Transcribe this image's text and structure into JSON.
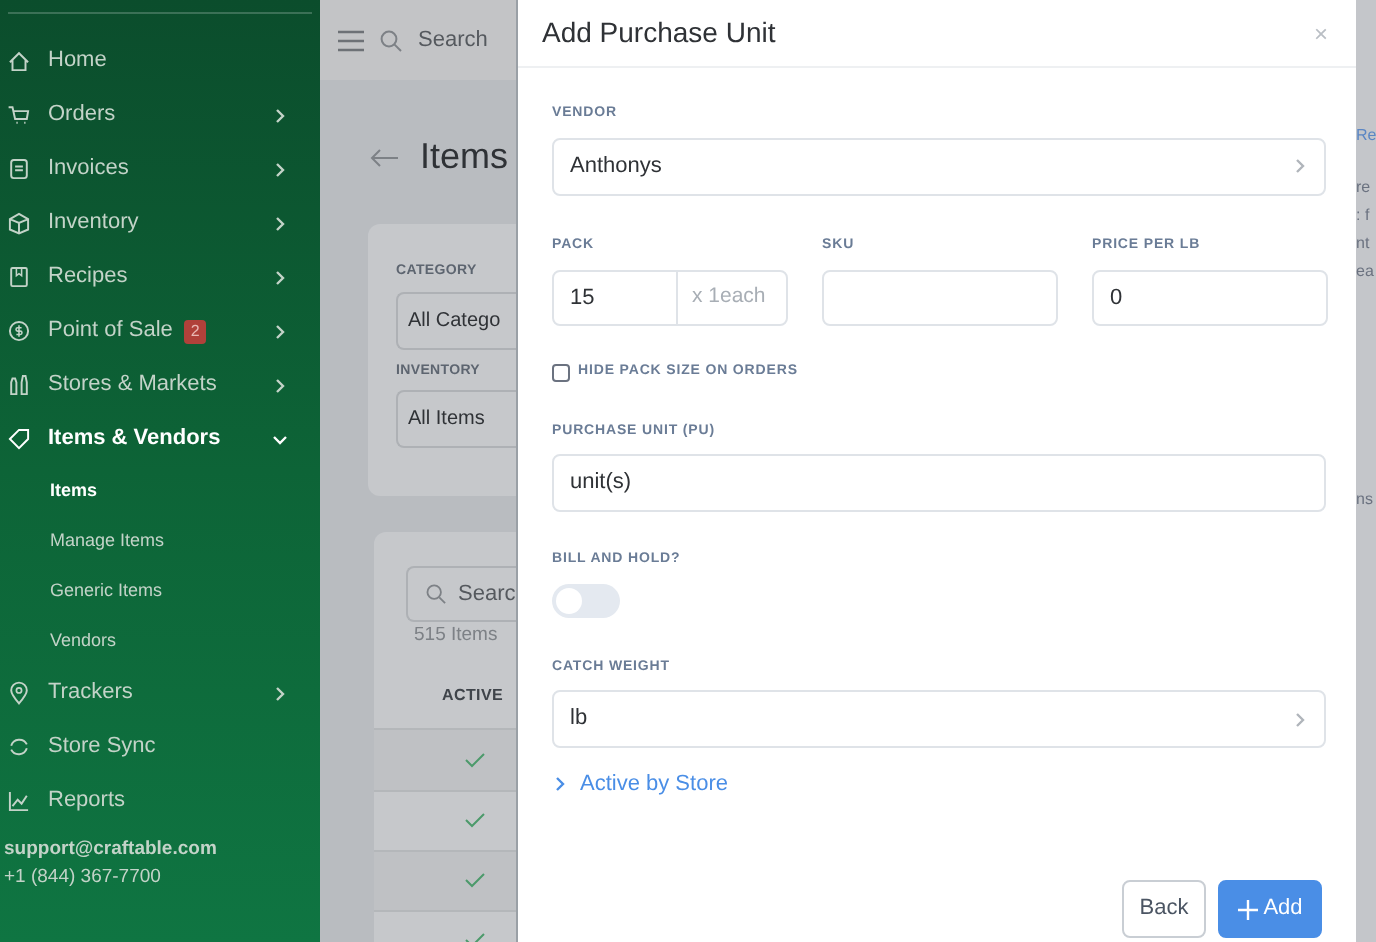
{
  "sidebar": {
    "items": [
      {
        "label": "Home",
        "kind": "link",
        "selected": false
      },
      {
        "label": "Orders",
        "kind": "group",
        "expanded": false,
        "selected": false
      },
      {
        "label": "Invoices",
        "kind": "group",
        "expanded": false,
        "selected": false
      },
      {
        "label": "Inventory",
        "kind": "group",
        "expanded": false,
        "selected": false
      },
      {
        "label": "Recipes",
        "kind": "group",
        "expanded": false,
        "selected": false
      },
      {
        "label": "Point of Sale",
        "kind": "group",
        "expanded": false,
        "selected": false,
        "badge": "2"
      },
      {
        "label": "Stores & Markets",
        "kind": "group",
        "expanded": false,
        "selected": false
      },
      {
        "label": "Items & Vendors",
        "kind": "group",
        "expanded": true,
        "selected": true,
        "children": [
          {
            "label": "Items",
            "selected": true
          },
          {
            "label": "Manage Items",
            "selected": false
          },
          {
            "label": "Generic Items",
            "selected": false
          },
          {
            "label": "Vendors",
            "selected": false
          }
        ]
      },
      {
        "label": "Trackers",
        "kind": "group",
        "expanded": false,
        "selected": false
      },
      {
        "label": "Store Sync",
        "kind": "link",
        "selected": false
      },
      {
        "label": "Reports",
        "kind": "link",
        "selected": false
      }
    ],
    "email": "support@craftable.com",
    "phone": "+1 (844) 367-7700"
  },
  "topbar": {
    "search_placeholder": "Search"
  },
  "page": {
    "title": "Items",
    "filters": [
      {
        "label": "CATEGORY",
        "value": "All Catego"
      },
      {
        "label": "INVENTORY",
        "value": "All Items"
      }
    ],
    "list_search_placeholder": "Searc",
    "count": "515 Items",
    "column": "ACTIVE",
    "rows": [
      {
        "active": true
      },
      {
        "active": true
      },
      {
        "active": true
      },
      {
        "active": true
      }
    ]
  },
  "right_fragments": [
    "Re",
    "re",
    ": f",
    "nt",
    "ea",
    "ns"
  ],
  "modal": {
    "title": "Add Purchase Unit",
    "close": "×",
    "vendor": {
      "label": "VENDOR",
      "value": "Anthonys"
    },
    "pack": {
      "label": "PACK",
      "value": "15",
      "addon": "x 1each"
    },
    "sku": {
      "label": "SKU"
    },
    "price": {
      "label": "PRICE PER LB",
      "value": "0"
    },
    "hide_pack": {
      "label": "HIDE PACK SIZE ON ORDERS",
      "checked": false
    },
    "purchase_unit": {
      "label": "PURCHASE UNIT (PU)",
      "value": "unit(s)"
    },
    "bill_hold": {
      "label": "BILL AND HOLD?",
      "on": false
    },
    "catch_weight": {
      "label": "CATCH WEIGHT",
      "value": "lb"
    },
    "active_by_store": {
      "label": "Active by Store",
      "expanded": false
    },
    "buttons": [
      {
        "label": "Back",
        "kind": "secondary"
      },
      {
        "label": "Add",
        "kind": "primary"
      }
    ]
  }
}
